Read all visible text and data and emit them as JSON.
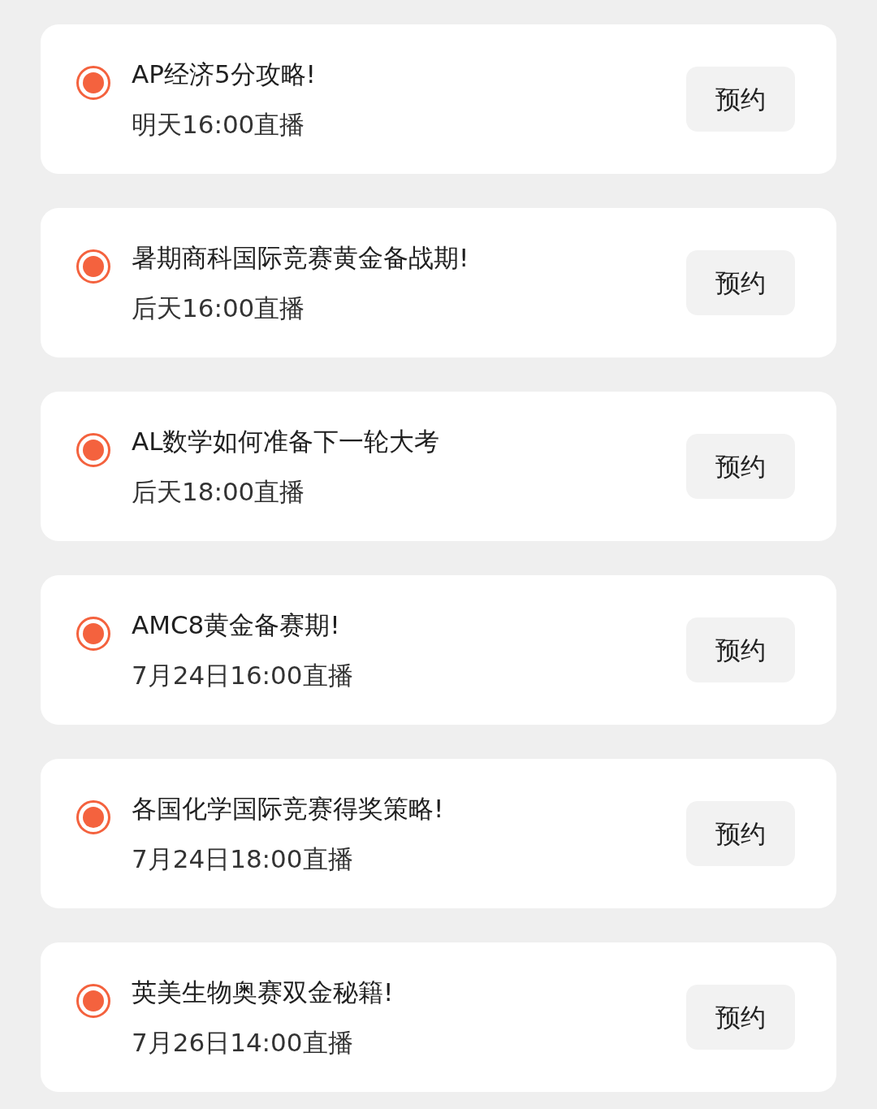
{
  "events": [
    {
      "title": "AP经济5分攻略!",
      "time": "明天16:00直播",
      "button": "预约"
    },
    {
      "title": "暑期商科国际竞赛黄金备战期!",
      "time": "后天16:00直播",
      "button": "预约"
    },
    {
      "title": "AL数学如何准备下一轮大考",
      "time": "后天18:00直播",
      "button": "预约"
    },
    {
      "title": "AMC8黄金备赛期!",
      "time": "7月24日16:00直播",
      "button": "预约"
    },
    {
      "title": "各国化学国际竞赛得奖策略!",
      "time": "7月24日18:00直播",
      "button": "预约"
    },
    {
      "title": "英美生物奥赛双金秘籍!",
      "time": "7月26日14:00直播",
      "button": "预约"
    }
  ]
}
